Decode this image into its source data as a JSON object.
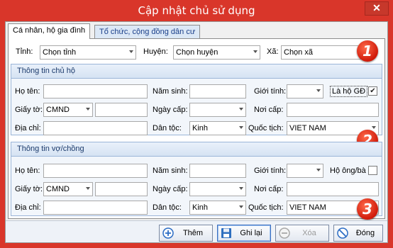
{
  "window": {
    "title": "Cập nhật chủ sử dụng",
    "close_symbol": "✕"
  },
  "tabs": [
    {
      "label": "Cá nhân, hộ gia đình",
      "active": true
    },
    {
      "label": "Tổ chức, cộng đồng dân cư",
      "active": false
    }
  ],
  "location": {
    "tinh_label": "Tỉnh:",
    "tinh_value": "Chọn tỉnh",
    "huyen_label": "Huyện:",
    "huyen_value": "Chọn huyện",
    "xa_label": "Xã:",
    "xa_value": "Chọn xã"
  },
  "owner": {
    "header": "Thông tin chủ hộ",
    "ho_ten_label": "Họ tên:",
    "ho_ten_value": "",
    "nam_sinh_label": "Năm sinh:",
    "nam_sinh_value": "",
    "gioi_tinh_label": "Giới tính:",
    "gioi_tinh_value": "",
    "la_ho_gd_label": "Là hộ GĐ",
    "la_ho_gd_checked": true,
    "giay_to_label": "Giấy tờ:",
    "giay_to_value": "CMND",
    "so_giay_to_value": "",
    "ngay_cap_label": "Ngày cấp:",
    "ngay_cap_value": "",
    "noi_cap_label": "Nơi cấp:",
    "noi_cap_value": "",
    "dia_chi_label": "Địa chỉ:",
    "dia_chi_value": "",
    "dan_toc_label": "Dân tộc:",
    "dan_toc_value": "Kinh",
    "quoc_tich_label": "Quốc tịch:",
    "quoc_tich_value": "VIET NAM"
  },
  "spouse": {
    "header": "Thông tin vợ/chồng",
    "ho_ten_label": "Họ tên:",
    "ho_ten_value": "",
    "nam_sinh_label": "Năm sinh:",
    "nam_sinh_value": "",
    "gioi_tinh_label": "Giới tính:",
    "gioi_tinh_value": "",
    "ho_ong_ba_label": "Hộ ông/bà",
    "ho_ong_ba_checked": false,
    "giay_to_label": "Giấy tờ:",
    "giay_to_value": "CMND",
    "so_giay_to_value": "",
    "ngay_cap_label": "Ngày cấp:",
    "ngay_cap_value": "",
    "noi_cap_label": "Nơi cấp:",
    "noi_cap_value": "",
    "dia_chi_label": "Địa chỉ:",
    "dia_chi_value": "",
    "dan_toc_label": "Dân tộc:",
    "dan_toc_value": "Kinh",
    "quoc_tich_label": "Quốc tịch:",
    "quoc_tich_value": "VIET NAM"
  },
  "badges": [
    "1",
    "2",
    "3"
  ],
  "buttons": {
    "add": "Thêm",
    "save": "Ghi lại",
    "delete": "Xóa",
    "close": "Đóng"
  },
  "colors": {
    "title_bar": "#d9362a",
    "badge": "#e0301a",
    "group_border": "#9bb5d8"
  }
}
